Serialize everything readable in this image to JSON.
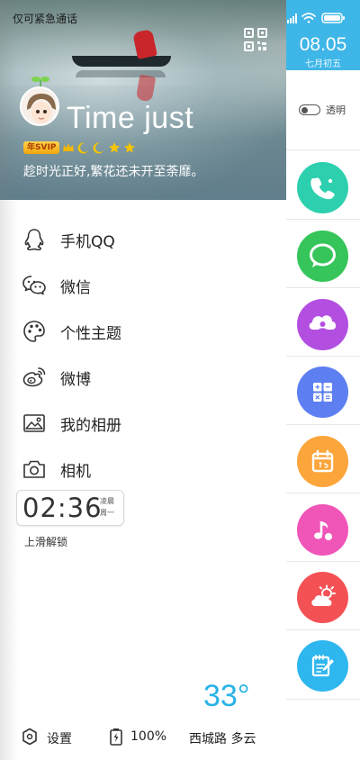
{
  "status_bar": {
    "carrier_text": "仅可紧急通话"
  },
  "profile": {
    "username": "Time just",
    "badge_label": "年SVIP",
    "signature": "趁时光正好,繁花还未开至荼靡。"
  },
  "menu": {
    "items": [
      {
        "label": "手机QQ",
        "icon": "qq-penguin-icon"
      },
      {
        "label": "微信",
        "icon": "wechat-icon"
      },
      {
        "label": "个性主题",
        "icon": "palette-icon"
      },
      {
        "label": "微博",
        "icon": "weibo-icon"
      },
      {
        "label": "我的相册",
        "icon": "photo-album-icon"
      },
      {
        "label": "相机",
        "icon": "camera-icon"
      }
    ]
  },
  "clock": {
    "time": "02:36",
    "period": "凌晨",
    "weekday": "周一",
    "unlock_text": "上滑解锁"
  },
  "weather": {
    "temperature": "33°",
    "location_weather": "西城路 多云"
  },
  "bottom_bar": {
    "settings_label": "设置",
    "battery_label": "100%"
  },
  "date_widget": {
    "date": "08.05",
    "lunar": "七月初五"
  },
  "transparency_toggle": {
    "label": "透明",
    "enabled": false
  },
  "dock_apps": [
    {
      "name": "phone-app-icon",
      "color": "#2ccfae"
    },
    {
      "name": "messages-app-icon",
      "color": "#35c55a"
    },
    {
      "name": "cloud-app-icon",
      "color": "#b34fe0"
    },
    {
      "name": "calculator-app-icon",
      "color": "#5d7ff2"
    },
    {
      "name": "calendar-app-icon",
      "color": "#fca53b"
    },
    {
      "name": "music-app-icon",
      "color": "#f055b8"
    },
    {
      "name": "weather-app-icon",
      "color": "#f45155"
    },
    {
      "name": "notes-app-icon",
      "color": "#2eb6ef"
    }
  ],
  "colors": {
    "accent_blue": "#3fb6e8",
    "temperature_blue": "#29b3e8"
  }
}
